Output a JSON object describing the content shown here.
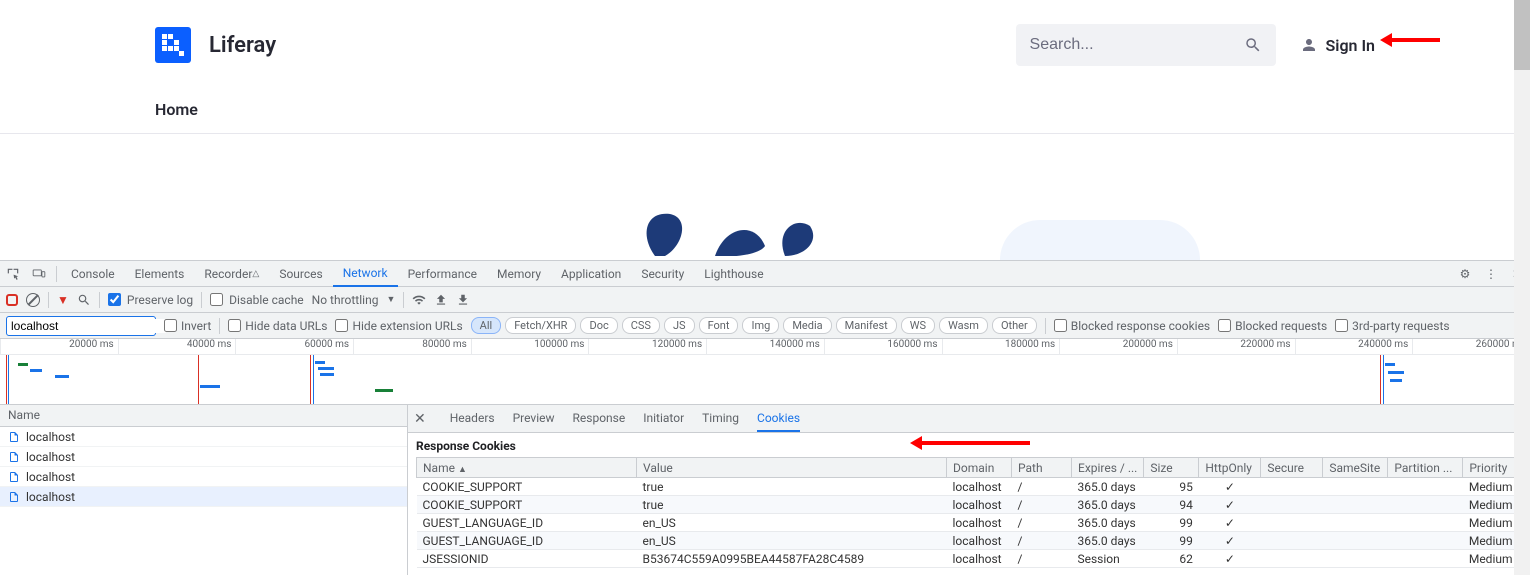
{
  "page": {
    "brand": "Liferay",
    "search_placeholder": "Search...",
    "signin": "Sign In",
    "nav_home": "Home"
  },
  "devtools": {
    "tabs": [
      "Console",
      "Elements",
      "Recorder",
      "Sources",
      "Network",
      "Performance",
      "Memory",
      "Application",
      "Security",
      "Lighthouse"
    ],
    "active_tab": "Network",
    "toolbar": {
      "preserve_log": "Preserve log",
      "preserve_log_checked": true,
      "disable_cache": "Disable cache",
      "disable_cache_checked": false,
      "throttling": "No throttling"
    },
    "filter": {
      "value": "localhost",
      "invert": "Invert",
      "hide_data_urls": "Hide data URLs",
      "hide_ext_urls": "Hide extension URLs",
      "chips": [
        "All",
        "Fetch/XHR",
        "Doc",
        "CSS",
        "JS",
        "Font",
        "Img",
        "Media",
        "Manifest",
        "WS",
        "Wasm",
        "Other"
      ],
      "active_chip": "All",
      "blocked_response_cookies": "Blocked response cookies",
      "blocked_requests": "Blocked requests",
      "third_party": "3rd-party requests"
    },
    "timeline_ticks": [
      "20000 ms",
      "40000 ms",
      "60000 ms",
      "80000 ms",
      "100000 ms",
      "120000 ms",
      "140000 ms",
      "160000 ms",
      "180000 ms",
      "200000 ms",
      "220000 ms",
      "240000 ms",
      "260000 ms"
    ],
    "requests": {
      "header": "Name",
      "items": [
        "localhost",
        "localhost",
        "localhost",
        "localhost"
      ],
      "selected_index": 3
    },
    "detail_tabs": [
      "Headers",
      "Preview",
      "Response",
      "Initiator",
      "Timing",
      "Cookies"
    ],
    "detail_active": "Cookies",
    "section_title": "Response Cookies",
    "cookie_columns": [
      "Name",
      "Value",
      "Domain",
      "Path",
      "Expires / ...",
      "Size",
      "HttpOnly",
      "Secure",
      "SameSite",
      "Partition ...",
      "Priority"
    ],
    "cookies": [
      {
        "name": "COOKIE_SUPPORT",
        "value": "true",
        "domain": "localhost",
        "path": "/",
        "expires": "365.0 days",
        "size": "95",
        "httpOnly": "✓",
        "secure": "",
        "sameSite": "",
        "partition": "",
        "priority": "Medium"
      },
      {
        "name": "COOKIE_SUPPORT",
        "value": "true",
        "domain": "localhost",
        "path": "/",
        "expires": "365.0 days",
        "size": "94",
        "httpOnly": "✓",
        "secure": "",
        "sameSite": "",
        "partition": "",
        "priority": "Medium"
      },
      {
        "name": "GUEST_LANGUAGE_ID",
        "value": "en_US",
        "domain": "localhost",
        "path": "/",
        "expires": "365.0 days",
        "size": "99",
        "httpOnly": "✓",
        "secure": "",
        "sameSite": "",
        "partition": "",
        "priority": "Medium"
      },
      {
        "name": "GUEST_LANGUAGE_ID",
        "value": "en_US",
        "domain": "localhost",
        "path": "/",
        "expires": "365.0 days",
        "size": "99",
        "httpOnly": "✓",
        "secure": "",
        "sameSite": "",
        "partition": "",
        "priority": "Medium"
      },
      {
        "name": "JSESSIONID",
        "value": "B53674C559A0995BEA44587FA28C4589",
        "domain": "localhost",
        "path": "/",
        "expires": "Session",
        "size": "62",
        "httpOnly": "✓",
        "secure": "",
        "sameSite": "",
        "partition": "",
        "priority": "Medium"
      }
    ]
  }
}
